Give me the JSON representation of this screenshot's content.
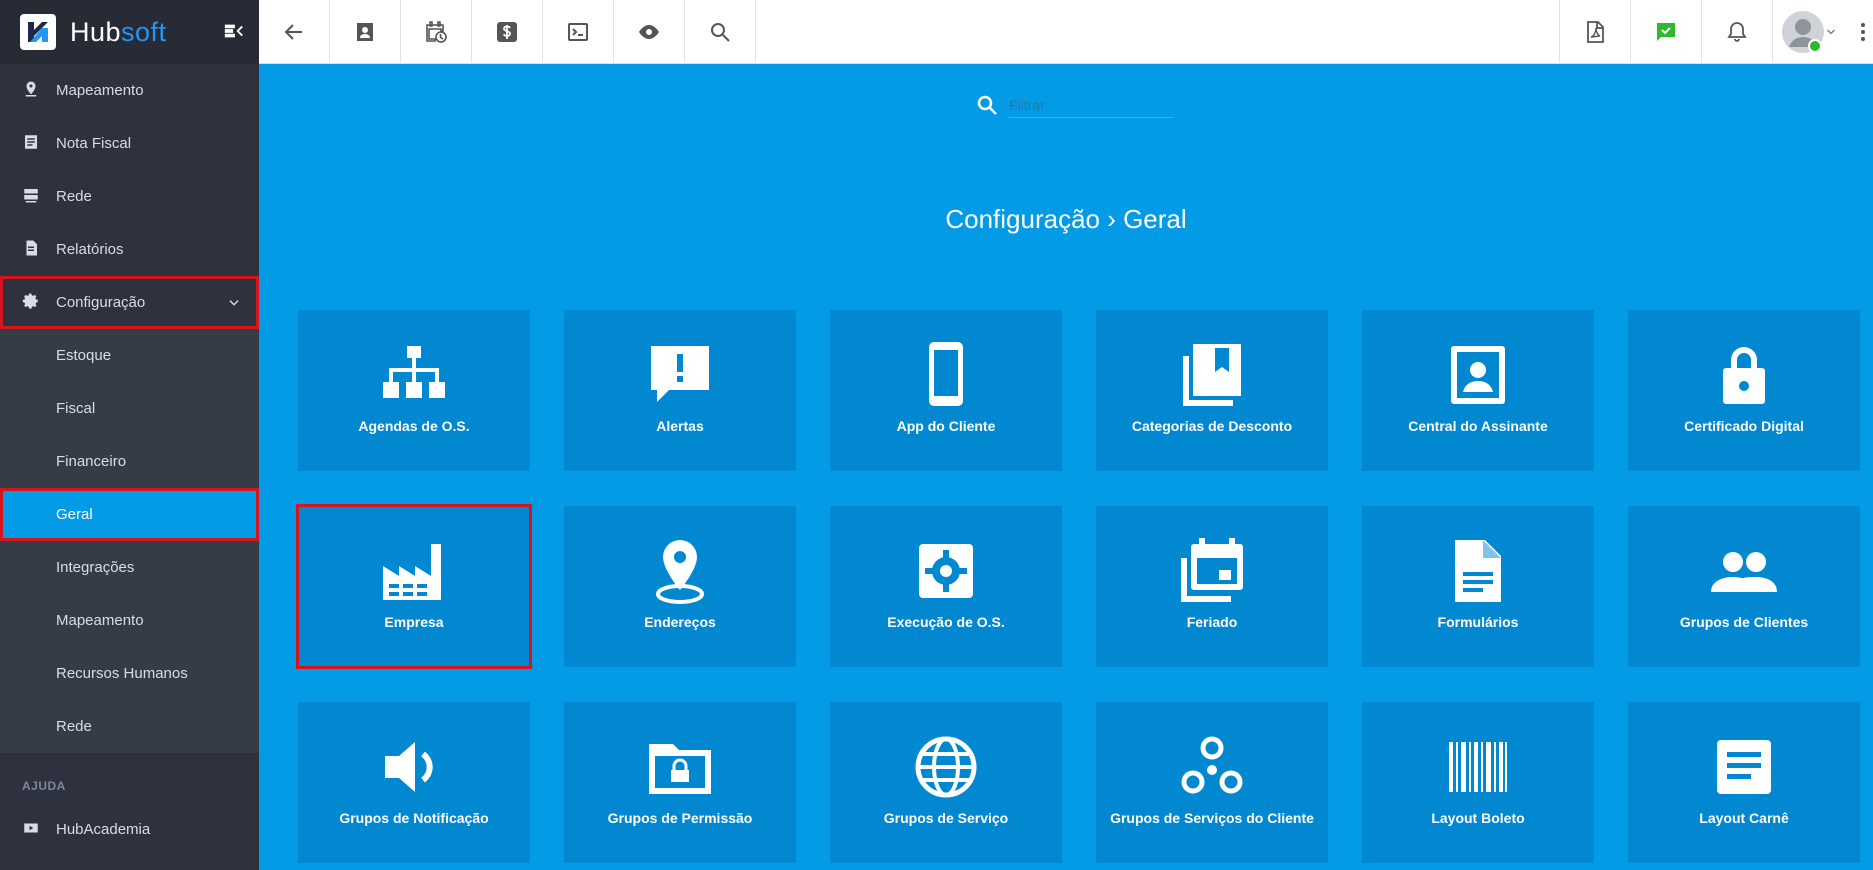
{
  "brand": {
    "name_part1": "Hub",
    "name_part2": "soft"
  },
  "sidebar": {
    "items_top": [
      {
        "label": "Mapeamento",
        "icon": "map-pin-icon"
      },
      {
        "label": "Nota Fiscal",
        "icon": "receipt-icon"
      },
      {
        "label": "Rede",
        "icon": "server-icon"
      },
      {
        "label": "Relatórios",
        "icon": "document-icon"
      }
    ],
    "config": {
      "label": "Configuração",
      "icon": "gear-icon",
      "expanded": true
    },
    "config_children": [
      {
        "label": "Estoque"
      },
      {
        "label": "Fiscal"
      },
      {
        "label": "Financeiro"
      },
      {
        "label": "Geral",
        "active": true
      },
      {
        "label": "Integrações"
      },
      {
        "label": "Mapeamento"
      },
      {
        "label": "Recursos Humanos"
      },
      {
        "label": "Rede"
      }
    ],
    "section_help": "AJUDA",
    "help_items": [
      {
        "label": "HubAcademia",
        "icon": "youtube-icon"
      }
    ]
  },
  "topbar": {
    "left_icons": [
      "back-arrow-icon",
      "contact-card-icon",
      "calendar-clock-icon",
      "dollar-icon",
      "terminal-icon",
      "eye-icon",
      "search-icon"
    ],
    "right_icons": [
      "pdf-icon",
      "chat-check-icon",
      "bell-icon",
      "avatar-icon"
    ]
  },
  "filter": {
    "placeholder": "Filtrar"
  },
  "breadcrumb": {
    "text": "Configuração › Geral"
  },
  "cards": [
    {
      "label": "Agendas de O.S.",
      "icon": "org-chart-icon"
    },
    {
      "label": "Alertas",
      "icon": "alert-message-icon"
    },
    {
      "label": "App do Cliente",
      "icon": "smartphone-icon"
    },
    {
      "label": "Categorias de Desconto",
      "icon": "bookmark-library-icon"
    },
    {
      "label": "Central do Assinante",
      "icon": "portrait-icon"
    },
    {
      "label": "Certificado Digital",
      "icon": "lock-icon"
    },
    {
      "label": "Empresa",
      "icon": "factory-icon"
    },
    {
      "label": "Endereços",
      "icon": "location-pin-icon"
    },
    {
      "label": "Execução de O.S.",
      "icon": "settings-box-icon"
    },
    {
      "label": "Feriado",
      "icon": "calendar-stack-icon"
    },
    {
      "label": "Formulários",
      "icon": "file-text-icon"
    },
    {
      "label": "Grupos de Clientes",
      "icon": "people-icon"
    },
    {
      "label": "Grupos de Notificação",
      "icon": "speaker-icon"
    },
    {
      "label": "Grupos de Permissão",
      "icon": "folder-lock-icon"
    },
    {
      "label": "Grupos de Serviço",
      "icon": "globe-icon"
    },
    {
      "label": "Grupos de Serviços do Cliente",
      "icon": "bubbles-icon"
    },
    {
      "label": "Layout Boleto",
      "icon": "barcode-icon"
    },
    {
      "label": "Layout Carnê",
      "icon": "notes-icon"
    }
  ],
  "colors": {
    "accent": "#039be5",
    "card": "#0288d1",
    "sidebar": "#2d323e",
    "highlight": "#d5141e"
  }
}
